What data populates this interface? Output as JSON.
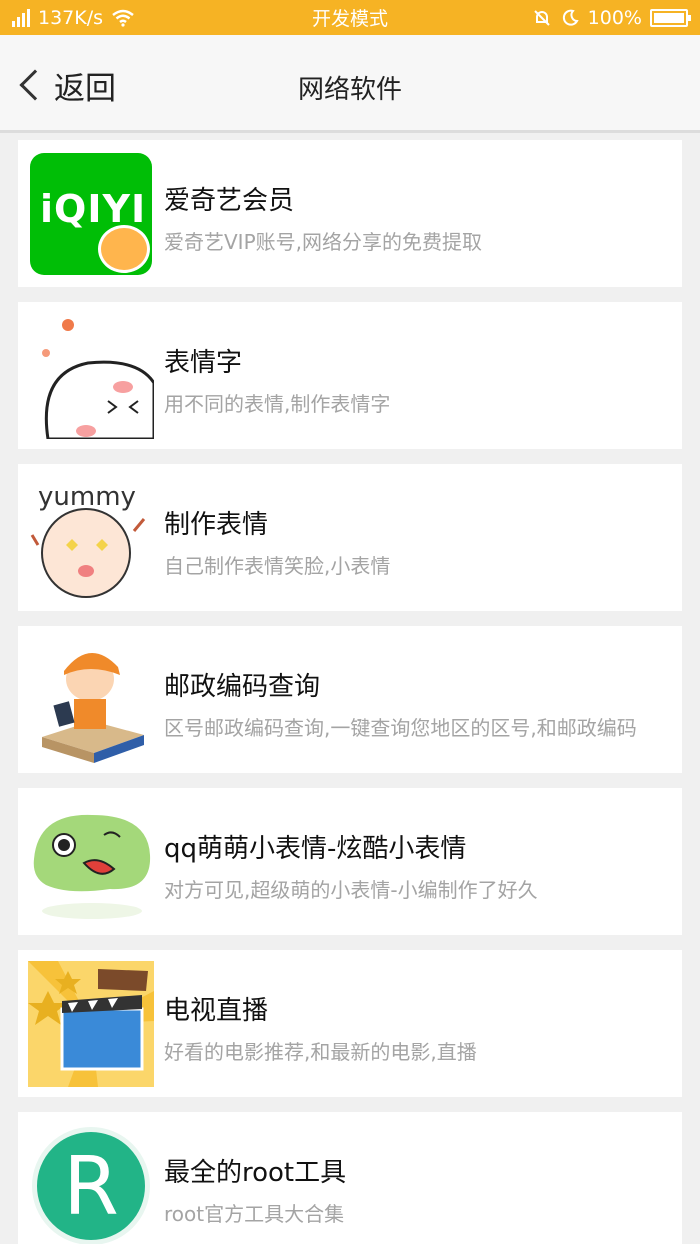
{
  "status_bar": {
    "network_speed": "137K/s",
    "network_type": "4G",
    "mode": "开发模式",
    "battery": "100%",
    "color": "#f6b324"
  },
  "header": {
    "back_label": "返回",
    "title": "网络软件"
  },
  "items": [
    {
      "title": "爱奇艺会员",
      "desc": "爱奇艺VIP账号,网络分享的免费提取",
      "icon": "iqiyi-icon",
      "icon_text": "iQIYI"
    },
    {
      "title": "表情字",
      "desc": "用不同的表情,制作表情字",
      "icon": "cute-face-icon"
    },
    {
      "title": "制作表情",
      "desc": "自己制作表情笑脸,小表情",
      "icon": "yummy-face-icon",
      "icon_text": "yummy"
    },
    {
      "title": "邮政编码查询",
      "desc": "区号邮政编码查询,一键查询您地区的区号,和邮政编码",
      "icon": "delivery-man-icon"
    },
    {
      "title": "qq萌萌小表情-炫酷小表情",
      "desc": "对方可见,超级萌的小表情-小编制作了好久",
      "icon": "green-blob-icon"
    },
    {
      "title": "电视直播",
      "desc": "好看的电影推荐,和最新的电影,直播",
      "icon": "film-clapper-icon"
    },
    {
      "title": "最全的root工具",
      "desc": "root官方工具大合集",
      "icon": "root-icon",
      "icon_text": "R"
    }
  ]
}
